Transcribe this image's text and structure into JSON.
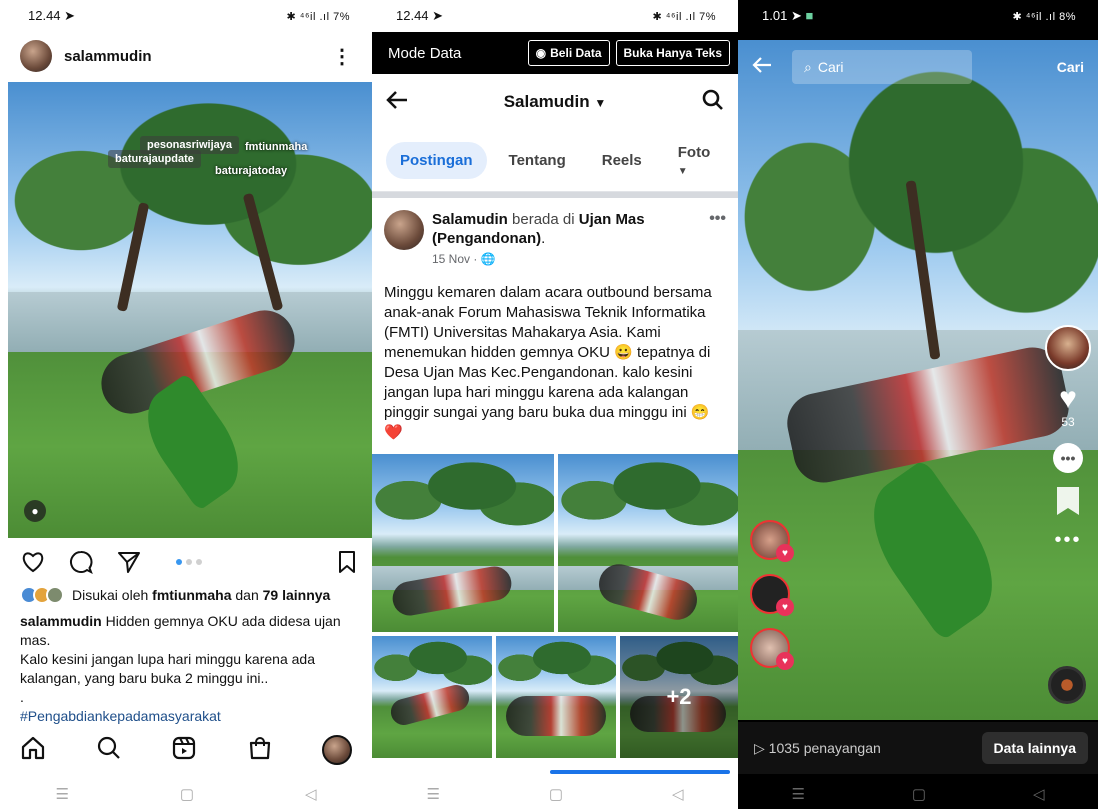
{
  "instagram": {
    "status": {
      "time": "12.44",
      "icons": "✱ ⁴⁶il .ıl 7%"
    },
    "username": "salammudin",
    "tags": [
      "pesonasriwijaya",
      "baturajaupdate",
      "fmtiunmaha",
      "baturajatoday"
    ],
    "likes": {
      "prefix": "Disukai oleh",
      "user": "fmtiunmaha",
      "joiner": "dan",
      "others": "79 lainnya"
    },
    "caption": {
      "author": "salammudin",
      "text": "Hidden gemnya OKU ada didesa ujan mas.",
      "line2": "Kalo kesini jangan lupa hari minggu karena ada kalangan, yang baru buka 2 minggu ini..",
      "line3": ".",
      "hashtag": "#Pengabdiankepadamasyarakat"
    },
    "carousel": {
      "count": 3,
      "active": 1
    }
  },
  "facebook": {
    "status": {
      "time": "12.44",
      "icons": "✱ ⁴⁶il .ıl 7%"
    },
    "data_mode": {
      "label": "Mode Data",
      "buy": "Beli Data",
      "text_only": "Buka Hanya Teks"
    },
    "profile_title": "Salamudin",
    "tabs": [
      "Postingan",
      "Tentang",
      "Reels",
      "Foto"
    ],
    "post": {
      "author": "Salamudin",
      "action": "berada di",
      "place": "Ujan Mas (Pengandonan)",
      "date": "15 Nov",
      "body": "Minggu kemaren dalam acara outbound bersama anak-anak Forum Mahasiswa Teknik Informatika (FMTI) Universitas Mahakarya Asia. Kami menemukan hidden gemnya OKU 😀 tepatnya di Desa Ujan Mas Kec.Pengandonan. kalo kesini jangan lupa hari minggu karena ada kalangan pinggir sungai yang baru buka dua minggu ini 😁❤️",
      "extra_photos": "+2"
    }
  },
  "tiktok": {
    "status": {
      "time": "1.01",
      "icons": "✱ ⁴⁶il .ıl 8%"
    },
    "search": {
      "placeholder": "Cari",
      "button": "Cari"
    },
    "likes_count": "53",
    "views": "1035 penayangan",
    "more_data": "Data lainnya"
  },
  "colors": {
    "fb_blue": "#1a6ed8",
    "tiktok_red": "#e8325a",
    "ig_blue": "#3897f0"
  }
}
